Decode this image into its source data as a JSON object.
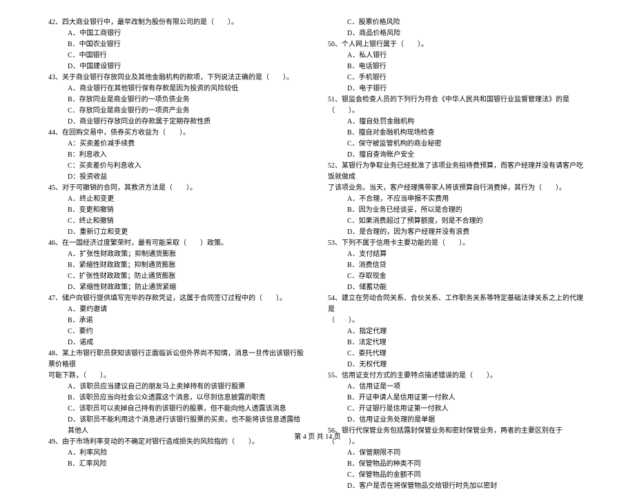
{
  "left": {
    "q42": {
      "text": "42、四大商业银行中，最早改制为股份有限公司的是（　　）。",
      "a": "A．中国工商银行",
      "b": "B．中国农业银行",
      "c": "C．中国银行",
      "d": "D．中国建设银行"
    },
    "q43": {
      "text": "43、关于商业银行存放同业及其他金融机构的款项，下列说法正确的是（　　）。",
      "a": "A．商业银行在其他银行保有存款是因为投资的风险较低",
      "b": "B．存放同业是商业银行的一项负债业务",
      "c": "C．存放同业是商业银行的一项资产业务",
      "d": "D．商业银行存放同业的存款属于定期存款性质"
    },
    "q44": {
      "text": "44、在回购交易中，债券买方收益为（　　）。",
      "a": "A：买卖差价减手续费",
      "b": "B：利息收入",
      "c": "C：买卖差价与利息收入",
      "d": "D：投资收益"
    },
    "q45": {
      "text": "45、对于可撤销的合同，其救济方法是（　　）。",
      "a": "A．终止和变更",
      "b": "B．变更和撤销",
      "c": "C．终止和撤销",
      "d": "D．重新订立和变更"
    },
    "q46": {
      "text": "46、在一国经济过度繁荣时，最有可能采取（　　）政策。",
      "a": "A．扩张性财政政策；抑制通货膨胀",
      "b": "B．紧缩性财政政策；抑制通货膨胀",
      "c": "C．扩张性财政政策；防止通货膨胀",
      "d": "D．紧缩性财政政策；防止通货紧缩"
    },
    "q47": {
      "text": "47、储户向银行提供填写完毕的存款凭证，这属于合同签订过程中的（　　）。",
      "a": "A．要约邀请",
      "b": "B．承诺",
      "c": "C．要约",
      "d": "D．诺成"
    },
    "q48": {
      "text1": "48、某上市银行职员获知该银行正面临诉讼但外界尚不知情，消息一旦传出该银行股票价格很",
      "text2": "可能下跌，（　　）。",
      "a": "A．该职员应当建议自己的朋友马上卖掉持有的该银行股票",
      "b": "B．该职员应当向社会公众透露这个消息，以尽到信息披露的职责",
      "c": "C．该职员可以卖掉自己持有的该银行的股票，但不能向他人透露该消息",
      "d": "D．该职员不能利用这个消息进行该银行股票的买卖，也不能将该信息透露给其他人"
    },
    "q49": {
      "text": "49、由于市场利率变动的不确定对银行造成损失的风险指的（　　）。",
      "a": "A．利率风险",
      "b": "B．汇率风险"
    }
  },
  "right": {
    "q49r": {
      "c": "C．股票价格风险",
      "d": "D．商品价格风险"
    },
    "q50": {
      "text": "50、个人网上银行属于（　　）。",
      "a": "A．私人银行",
      "b": "B．电话银行",
      "c": "C．手机银行",
      "d": "D．电子银行"
    },
    "q51": {
      "text": "51、银监会检查人员的下列行为符合《中华人民共和国银行业监督管理法》的是（　　）。",
      "a": "A．擅自处罚金融机构",
      "b": "B．擅自对金融机构现场检查",
      "c": "C．保守被监管机构的商业秘密",
      "d": "D．擅自查询账户安全"
    },
    "q52": {
      "text1": "52、某银行为争取业务已经批准了该项业务招待费预算，而客户经理并没有请客户吃饭就做成",
      "text2": "了该项业务。当天，客户经理携带家人将该预算自行消费掉，其行为（　　）。",
      "a": "A．不合理，不应当申报不实费用",
      "b": "B．因为业务已经谈妥，所以是合理的",
      "c": "C．如果消费超过了预算额度，则是不合理的",
      "d": "D．是合理的，因为客户经理并没有浪费"
    },
    "q53": {
      "text": "53、下列不属于信用卡主要功能的是（　　）。",
      "a": "A．支付结算",
      "b": "B．消费信贷",
      "c": "C．存取现金",
      "d": "D．储蓄功能"
    },
    "q54": {
      "text1": "54、建立在劳动合同关系、合伙关系、工作职务关系等特定基础法律关系之上的代理是",
      "text2": "（　　）。",
      "a": "A．指定代理",
      "b": "B．法定代理",
      "c": "C．委托代理",
      "d": "D．无权代理"
    },
    "q55": {
      "text": "55、信用证支付方式的主要特点描述错误的是（　　）。",
      "a": "A．信用证是一项",
      "b": "B．开证申请人是信用证第一付款人",
      "c": "C．开证银行是信用证第一付款人",
      "d": "D．信用证业务处理的是单据"
    },
    "q56": {
      "text": "56、银行代保管业务包括露封保管业务和密封保管业务，两者的主要区别在于（　　）。",
      "a": "A．保管期限不同",
      "b": "B．保管物品的种类不同",
      "c": "C．保管物品的金额不同",
      "d": "D．客户是否在将保管物品交给银行时先加以密封"
    }
  },
  "footer": "第 4 页 共 14 页"
}
